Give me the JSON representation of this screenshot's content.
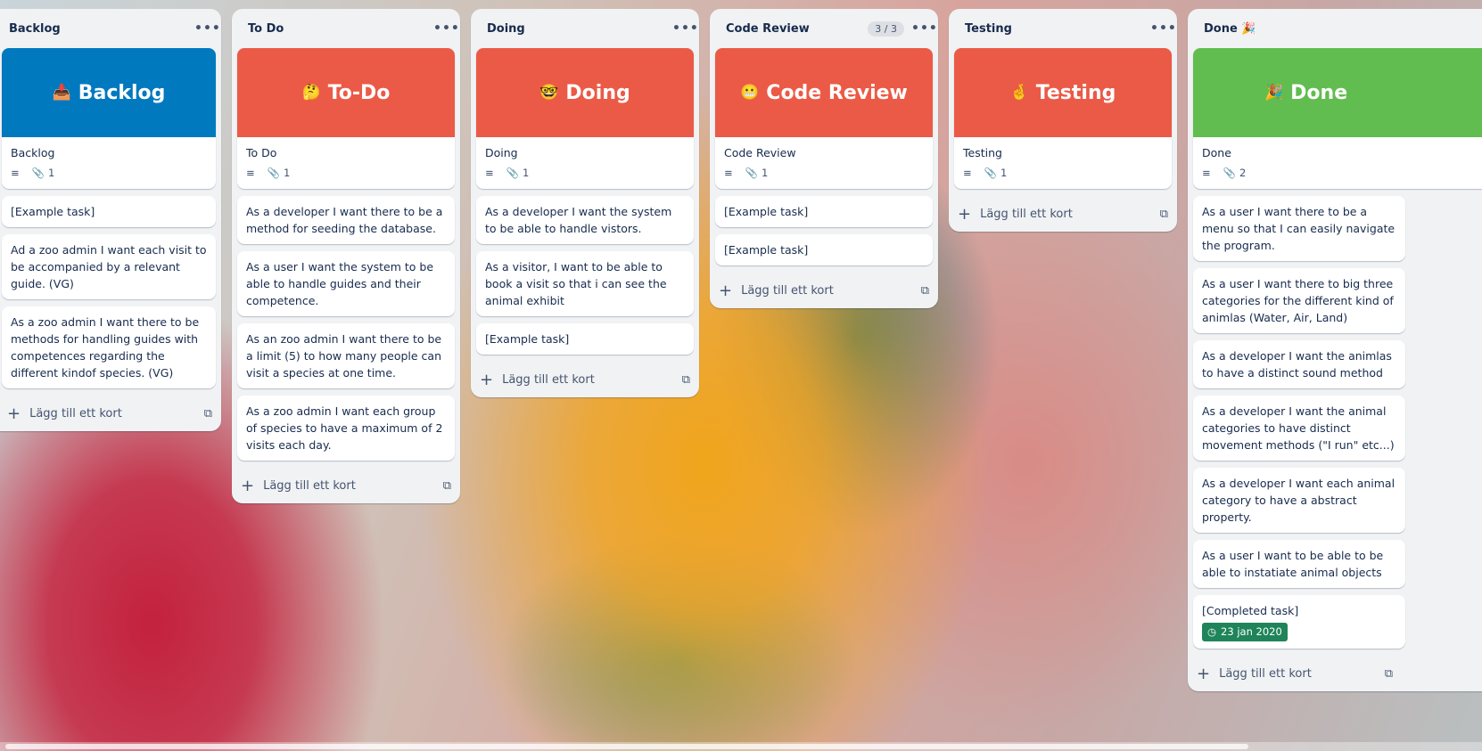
{
  "lists": [
    {
      "title": "Backlog",
      "cover": {
        "emoji": "📥",
        "text": "Backlog",
        "color": "#0079bf"
      },
      "cover_card": {
        "title": "Backlog",
        "attachments": "1"
      },
      "cards": [
        "[Example task]",
        "Ad a zoo admin I want each visit to be accompanied by a relevant guide. (VG)",
        "As a zoo admin I want there to be methods for handling guides with competences regarding the different kindof species. (VG)"
      ],
      "add_label": "Lägg till ett kort"
    },
    {
      "title": "To Do",
      "cover": {
        "emoji": "🤔",
        "text": "To-Do",
        "color": "#eb5a46"
      },
      "cover_card": {
        "title": "To Do",
        "attachments": "1"
      },
      "cards": [
        "As a developer I want there to be a method for seeding the database.",
        "As a user I want the system to be able to handle guides and their competence.",
        "As an zoo admin I want there to be a limit (5) to how many people can visit a species at one time.",
        "As a zoo admin I want each group of species to have a maximum of 2 visits each day."
      ],
      "add_label": "Lägg till ett kort"
    },
    {
      "title": "Doing",
      "cover": {
        "emoji": "🤓",
        "text": "Doing",
        "color": "#eb5a46"
      },
      "cover_card": {
        "title": "Doing",
        "attachments": "1"
      },
      "cards": [
        "As a developer I want the system to be able to handle vistors.",
        "As a visitor, I want to be able to book a visit so that i can see the animal exhibit",
        "[Example task]"
      ],
      "add_label": "Lägg till ett kort"
    },
    {
      "title": "Code Review",
      "count": "3 / 3",
      "cover": {
        "emoji": "😬",
        "text": "Code Review",
        "color": "#eb5a46"
      },
      "cover_card": {
        "title": "Code Review",
        "attachments": "1"
      },
      "cards": [
        "[Example task]",
        "[Example task]"
      ],
      "add_label": "Lägg till ett kort"
    },
    {
      "title": "Testing",
      "cover": {
        "emoji": "🤞",
        "text": "Testing",
        "color": "#eb5a46"
      },
      "cover_card": {
        "title": "Testing",
        "attachments": "1"
      },
      "cards": [],
      "add_label": "Lägg till ett kort"
    },
    {
      "title": "Done 🎉",
      "cover": {
        "emoji": "🎉",
        "text": "Done",
        "color": "#61bd4f"
      },
      "cover_card": {
        "title": "Done",
        "attachments": "2"
      },
      "cards": [
        "As a user I want there to be a menu so that I can easily navigate the program.",
        "As a user I want there to big three categories for the different kind of animlas (Water, Air, Land)",
        "As a developer I want the animlas to have a distinct sound method",
        "As a developer I want the animal categories to have distinct movement methods (\"I run\" etc...)",
        "As a developer I want each animal category to have a abstract property.",
        "As a user I want to be able to be able to instatiate animal objects"
      ],
      "completed_card": {
        "title": "[Completed task]",
        "due": "23 jan 2020",
        "due_color": "#1f845a"
      },
      "add_label": "Lägg till ett kort"
    }
  ],
  "icons": {
    "description": "description-icon",
    "attachment": "paperclip-icon",
    "menu": "ellipsis-icon",
    "add": "plus-icon",
    "template": "card-template-icon",
    "due": "clock-icon"
  }
}
